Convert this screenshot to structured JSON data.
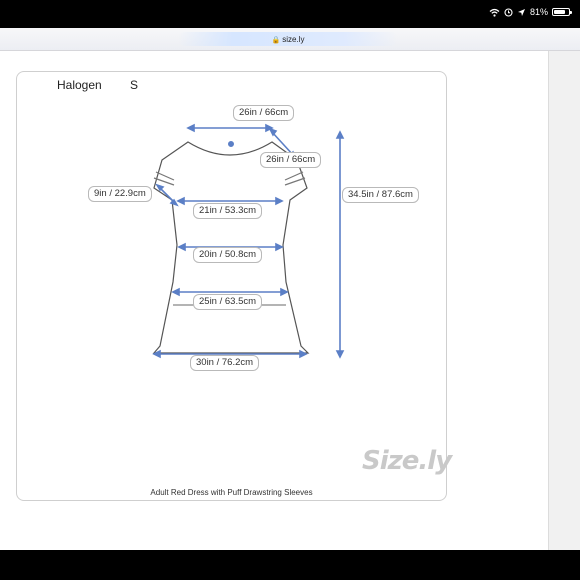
{
  "status_bar": {
    "battery": "81%",
    "battery_level": 0.81,
    "icons": [
      "wifi-icon",
      "alarm-icon",
      "location-icon",
      "battery-icon"
    ]
  },
  "browser": {
    "url": "size.ly",
    "icon": "lock-icon"
  },
  "chart": {
    "brand": "Halogen",
    "size": "S",
    "measurements": [
      {
        "key": "neck_width",
        "label": "26in / 66cm"
      },
      {
        "key": "shoulder",
        "label": "26in / 66cm"
      },
      {
        "key": "sleeve_length",
        "label": "9in / 22.9cm"
      },
      {
        "key": "chest",
        "label": "21in / 53.3cm"
      },
      {
        "key": "waist",
        "label": "20in / 50.8cm"
      },
      {
        "key": "hip",
        "label": "25in / 63.5cm"
      },
      {
        "key": "hem",
        "label": "30in / 76.2cm"
      },
      {
        "key": "length",
        "label": "34.5in / 87.6cm"
      }
    ],
    "caption": "Adult Red Dress with Puff Drawstring Sleeves",
    "logo": "Size.ly",
    "accent_color": "#5b7fc6"
  }
}
